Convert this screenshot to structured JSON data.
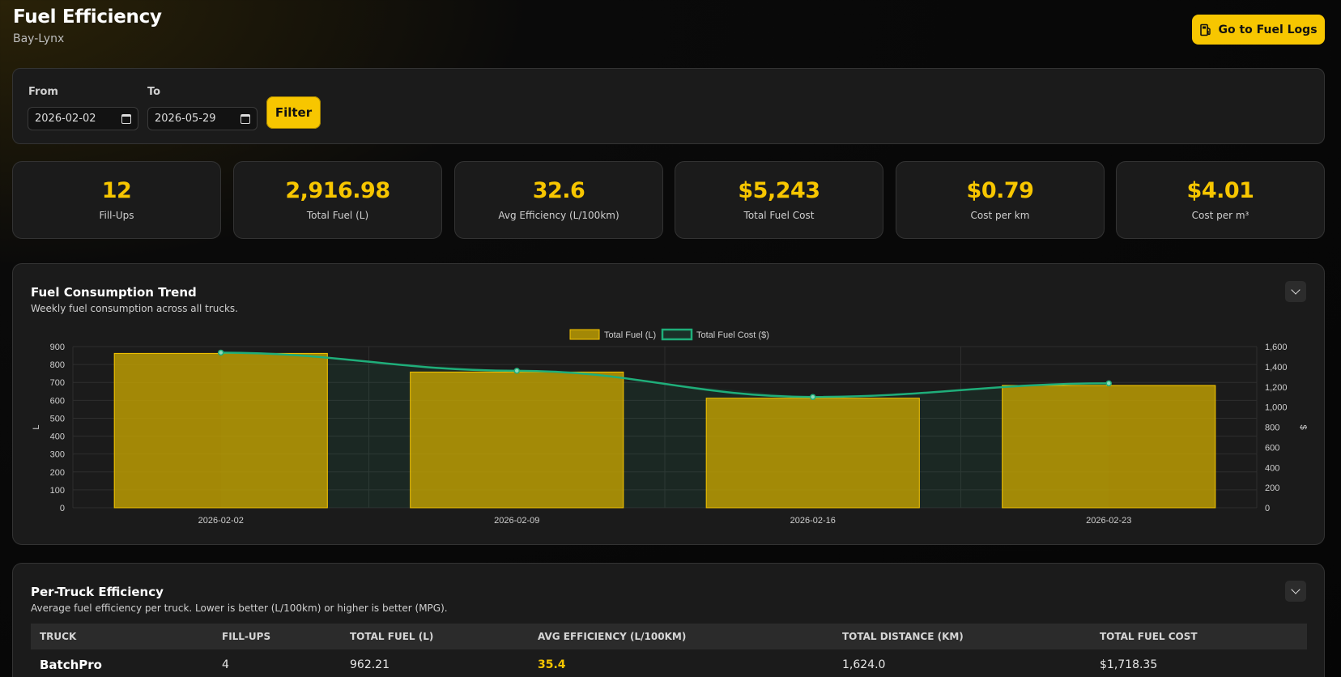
{
  "header": {
    "title": "Fuel Efficiency",
    "subtitle": "Bay-Lynx",
    "fuel_logs_button": "Go to Fuel Logs"
  },
  "filter": {
    "from_label": "From",
    "from_value": "2026-02-02",
    "to_label": "To",
    "to_value": "2026-05-29",
    "button": "Filter"
  },
  "stats": [
    {
      "value": "12",
      "label": "Fill-Ups"
    },
    {
      "value": "2,916.98",
      "label": "Total Fuel (L)"
    },
    {
      "value": "32.6",
      "label": "Avg Efficiency (L/100km)"
    },
    {
      "value": "$5,243",
      "label": "Total Fuel Cost"
    },
    {
      "value": "$0.79",
      "label": "Cost per km"
    },
    {
      "value": "$4.01",
      "label": "Cost per m³"
    }
  ],
  "trend_panel": {
    "title": "Fuel Consumption Trend",
    "subtitle": "Weekly fuel consumption across all trucks."
  },
  "chart_data": {
    "type": "bar",
    "categories": [
      "2026-02-02",
      "2026-02-09",
      "2026-02-16",
      "2026-02-23"
    ],
    "series": [
      {
        "name": "Total Fuel (L)",
        "type": "bar",
        "axis": "left",
        "values": [
          862,
          758,
          612,
          683
        ],
        "color": "#c9a700"
      },
      {
        "name": "Total Fuel Cost ($)",
        "type": "line",
        "axis": "right",
        "values": [
          1540,
          1360,
          1100,
          1235
        ],
        "color": "#1fae7a"
      }
    ],
    "ylabel": "L",
    "y2label": "$",
    "ylim": [
      0,
      900
    ],
    "y2lim": [
      0,
      1600
    ],
    "yticks": [
      "0",
      "100",
      "200",
      "300",
      "400",
      "500",
      "600",
      "700",
      "800",
      "900"
    ],
    "y2ticks": [
      "0",
      "200",
      "400",
      "600",
      "800",
      "1,000",
      "1,200",
      "1,400",
      "1,600"
    ],
    "legend": "top-center",
    "grid": true
  },
  "truck_panel": {
    "title": "Per-Truck Efficiency",
    "subtitle": "Average fuel efficiency per truck. Lower is better (L/100km) or higher is better (MPG).",
    "columns": [
      "Truck",
      "Fill-Ups",
      "Total Fuel (L)",
      "Avg Efficiency (L/100km)",
      "Total Distance (km)",
      "Total Fuel Cost"
    ],
    "rows": [
      [
        "BatchPro",
        "4",
        "962.21",
        "35.4",
        "1,624.0",
        "$1,718.35"
      ]
    ]
  },
  "colors": {
    "accent": "#f7c600",
    "line": "#1fae7a",
    "panel": "#1b1b1b"
  }
}
